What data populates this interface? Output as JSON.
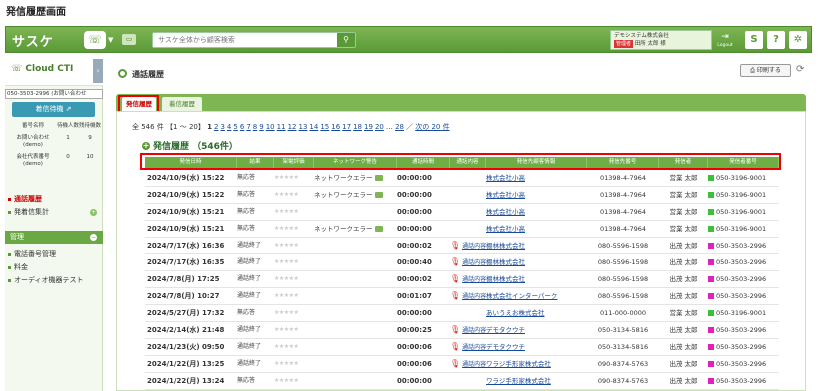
{
  "page_title": "発信履歴画面",
  "topbar": {
    "logo": "サスケ",
    "search_placeholder": "サスケ全体から顧客検索",
    "user_company": "デモシステム株式会社",
    "user_role": "管理者",
    "user_name": "田所 太郎 様",
    "logout_label": "Logout",
    "colors": {
      "bar": "#6aa844",
      "accent": "#5a9a36"
    }
  },
  "sidebar": {
    "title": "Cloud CTI",
    "line_select": "050-3503-2996 (お問い合わせ",
    "wait_button": "着信待機",
    "count_headers": [
      "番号名称",
      "待機人数",
      "残待機数"
    ],
    "count_rows": [
      {
        "name": "お問い合わせ(demo)",
        "waiting": "1",
        "remaining": "9"
      },
      {
        "name": "会社代表番号(demo)",
        "waiting": "0",
        "remaining": "10"
      }
    ],
    "nav": [
      "通話履歴",
      "発着信集計"
    ],
    "section_manage": "管理",
    "manage_nav": [
      "電話番号管理",
      "料金",
      "オーディオ機器テスト"
    ]
  },
  "main": {
    "breadcrumb": "通話履歴",
    "print_label": "印刷する",
    "tabs": [
      "発信履歴",
      "着信履歴"
    ],
    "pager": {
      "total": "全 546 件",
      "range": "【1 ～ 20】",
      "current": "1",
      "pages": [
        "2",
        "3",
        "4",
        "5",
        "6",
        "7",
        "8",
        "9",
        "10",
        "11",
        "12",
        "13",
        "14",
        "15",
        "16",
        "17",
        "18",
        "19",
        "20"
      ],
      "ellipsis": "…",
      "last": "28",
      "next": "次の 20 件"
    },
    "subtitle": "発信履歴 （546件）",
    "columns": [
      "発信日時",
      "結果",
      "架電評価",
      "ネットワーク警告",
      "通話時間",
      "通話内容",
      "発信先顧客情報",
      "発信先番号",
      "発信者",
      "発信者番号"
    ],
    "rows": [
      {
        "dt": "2024/10/9(水) 15:22",
        "result": "無応答",
        "stars": "★★★★★",
        "net": "ネットワークエラー",
        "netIcon": true,
        "time": "00:00:00",
        "rec": "",
        "cust": "株式会社小高",
        "cnum": "01398-4-7964",
        "op": "営業 太郎",
        "onum": "050-3196-9001",
        "color": "#3ac03a"
      },
      {
        "dt": "2024/10/9(水) 15:22",
        "result": "無応答",
        "stars": "★★★★★",
        "net": "ネットワークエラー",
        "netIcon": true,
        "time": "00:00:00",
        "rec": "",
        "cust": "株式会社小高",
        "cnum": "01398-4-7964",
        "op": "営業 太郎",
        "onum": "050-3196-9001",
        "color": "#3ac03a"
      },
      {
        "dt": "2024/10/9(水) 15:21",
        "result": "無応答",
        "stars": "★★★★★",
        "net": "",
        "netIcon": false,
        "time": "00:00:00",
        "rec": "",
        "cust": "株式会社小高",
        "cnum": "01398-4-7964",
        "op": "営業 太郎",
        "onum": "050-3196-9001",
        "color": "#3ac03a"
      },
      {
        "dt": "2024/10/9(水) 15:21",
        "result": "無応答",
        "stars": "★★★★★",
        "net": "ネットワークエラー",
        "netIcon": true,
        "time": "00:00:00",
        "rec": "",
        "cust": "株式会社小高",
        "cnum": "01398-4-7964",
        "op": "営業 太郎",
        "onum": "050-3196-9001",
        "color": "#3ac03a"
      },
      {
        "dt": "2024/7/17(水) 16:36",
        "result": "通話終了",
        "stars": "★★★★★",
        "net": "",
        "netIcon": false,
        "time": "00:00:02",
        "rec": "通話内容",
        "cust": "棚林株式会社",
        "cnum": "080-5596-1598",
        "op": "出茂 太郎",
        "onum": "050-3503-2996",
        "color": "#e020c0"
      },
      {
        "dt": "2024/7/17(水) 16:35",
        "result": "通話終了",
        "stars": "★★★★★",
        "net": "",
        "netIcon": false,
        "time": "00:00:40",
        "rec": "通話内容",
        "cust": "棚林株式会社",
        "cnum": "080-5596-1598",
        "op": "出茂 太郎",
        "onum": "050-3503-2996",
        "color": "#e020c0"
      },
      {
        "dt": "2024/7/8(月) 17:25",
        "result": "通話終了",
        "stars": "★★★★★",
        "net": "",
        "netIcon": false,
        "time": "00:00:02",
        "rec": "通話内容",
        "cust": "棚林株式会社",
        "cnum": "080-5596-1598",
        "op": "出茂 太郎",
        "onum": "050-3503-2996",
        "color": "#e020c0"
      },
      {
        "dt": "2024/7/8(月) 10:27",
        "result": "通話終了",
        "stars": "★★★★★",
        "net": "",
        "netIcon": false,
        "time": "00:01:07",
        "rec": "通話内容",
        "cust": "株式会社インターパーク",
        "cnum": "080-5596-1598",
        "op": "出茂 太郎",
        "onum": "050-3503-2996",
        "color": "#e020c0"
      },
      {
        "dt": "2024/5/27(月) 17:32",
        "result": "無応答",
        "stars": "★★★★★",
        "net": "",
        "netIcon": false,
        "time": "00:00:00",
        "rec": "",
        "cust": "あいうえお株式会社",
        "cnum": "011-000-0000",
        "op": "営業 太郎",
        "onum": "050-3196-9001",
        "color": "#3ac03a"
      },
      {
        "dt": "2024/2/14(水) 21:48",
        "result": "通話終了",
        "stars": "★★★★★",
        "net": "",
        "netIcon": false,
        "time": "00:00:25",
        "rec": "通話内容",
        "cust": "デモタクウチ",
        "cnum": "050-3134-5816",
        "op": "出茂 太郎",
        "onum": "050-3503-2996",
        "color": "#e020c0"
      },
      {
        "dt": "2024/1/23(火) 09:50",
        "result": "通話終了",
        "stars": "★★★★★",
        "net": "",
        "netIcon": false,
        "time": "00:00:06",
        "rec": "通話内容",
        "cust": "デモタクウチ",
        "cnum": "050-3134-5816",
        "op": "出茂 太郎",
        "onum": "050-3503-2996",
        "color": "#e020c0"
      },
      {
        "dt": "2024/1/22(月) 13:25",
        "result": "通話終了",
        "stars": "★★★★★",
        "net": "",
        "netIcon": false,
        "time": "00:00:06",
        "rec": "通話内容",
        "cust": "ワラジ手形家株式会社",
        "cnum": "090-8374-5763",
        "op": "出茂 太郎",
        "onum": "050-3503-2996",
        "color": "#e020c0"
      },
      {
        "dt": "2024/1/22(月) 13:24",
        "result": "無応答",
        "stars": "★★★★★",
        "net": "",
        "netIcon": false,
        "time": "00:00:00",
        "rec": "",
        "cust": "ワラジ手形家株式会社",
        "cnum": "090-8374-5763",
        "op": "出茂 太郎",
        "onum": "050-3503-2996",
        "color": "#e020c0"
      }
    ]
  }
}
